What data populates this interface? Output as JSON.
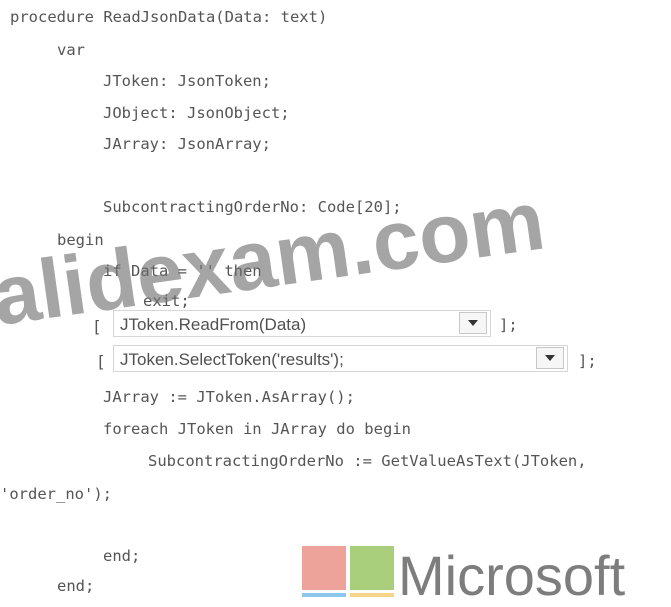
{
  "code": {
    "l01": "procedure ReadJsonData(Data: text)",
    "l02": "var",
    "l03": "JToken: JsonToken;",
    "l04": "JObject: JsonObject;",
    "l05": "JArray: JsonArray;",
    "l06": "SubcontractingOrderNo: Code[20];",
    "l07": "begin",
    "l08": "if Data = '' then",
    "l09": "exit;",
    "l10": "JArray := JToken.AsArray();",
    "l11": "foreach JToken in JArray do begin",
    "l12": "SubcontractingOrderNo := GetValueAsText(JToken,",
    "l13": "'order_no');",
    "l14": "end;",
    "l15": "end;"
  },
  "dropdowns": {
    "first": {
      "value": "JToken.ReadFrom(Data)",
      "open_bracket": "[",
      "close": "];"
    },
    "second": {
      "value": "JToken.SelectToken('results');",
      "open_bracket": "[",
      "close": "];"
    }
  },
  "watermark": {
    "text": "alidexam.com"
  },
  "logo": {
    "text": "Microsoft",
    "colors": [
      "#f35325",
      "#81bc06",
      "#05a6f0",
      "#ffba08"
    ]
  }
}
